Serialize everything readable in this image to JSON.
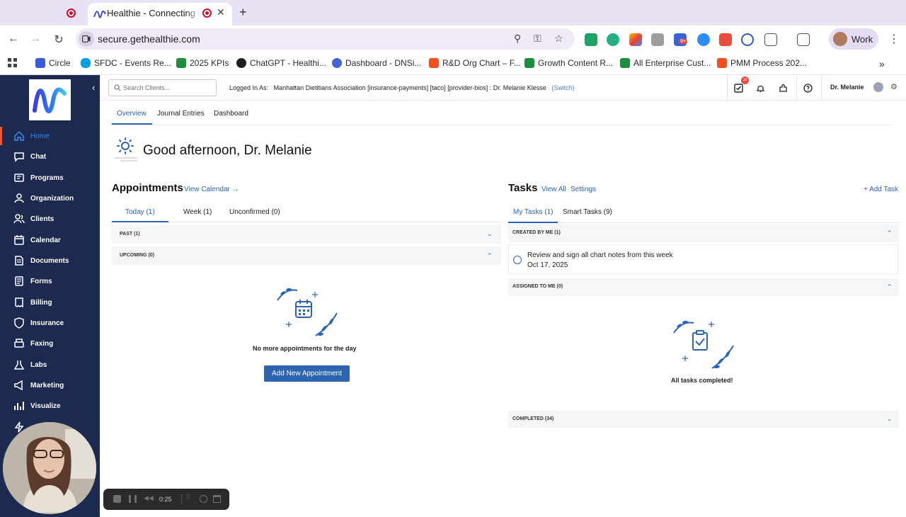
{
  "browser": {
    "active_tab_title": "Healthie - Connecting Pro",
    "url": "secure.gethealthie.com",
    "profile_label": "Work",
    "bookmarks": [
      {
        "label": "Circle",
        "color": "#3b5bdb"
      },
      {
        "label": "SFDC - Events Re...",
        "color": "#00a1e0"
      },
      {
        "label": "2025 KPIs",
        "color": "#1e8e3e"
      },
      {
        "label": "ChatGPT - Healthi...",
        "color": "#202020"
      },
      {
        "label": "Dashboard - DNSi...",
        "color": "#3f66d4"
      },
      {
        "label": "R&D Org Chart – F...",
        "color": "#f24e1e"
      },
      {
        "label": "Growth Content R...",
        "color": "#1e8e3e"
      },
      {
        "label": "All Enterprise Cust...",
        "color": "#1e8e3e"
      },
      {
        "label": "PMM Process 202...",
        "color": "#f24e1e"
      }
    ],
    "extension_badge": "9+"
  },
  "sidebar": {
    "items": [
      {
        "label": "Home",
        "icon": "home-icon"
      },
      {
        "label": "Chat",
        "icon": "chat-icon"
      },
      {
        "label": "Programs",
        "icon": "programs-icon"
      },
      {
        "label": "Organization",
        "icon": "organization-icon"
      },
      {
        "label": "Clients",
        "icon": "clients-icon"
      },
      {
        "label": "Calendar",
        "icon": "calendar-icon"
      },
      {
        "label": "Documents",
        "icon": "documents-icon"
      },
      {
        "label": "Forms",
        "icon": "forms-icon"
      },
      {
        "label": "Billing",
        "icon": "billing-icon"
      },
      {
        "label": "Insurance",
        "icon": "insurance-icon"
      },
      {
        "label": "Faxing",
        "icon": "fax-icon"
      },
      {
        "label": "Labs",
        "icon": "labs-icon"
      },
      {
        "label": "Marketing",
        "icon": "marketing-icon"
      },
      {
        "label": "Visualize",
        "icon": "visualize-icon"
      }
    ]
  },
  "topbar": {
    "search_placeholder": "Search Clients...",
    "logged_in_label": "Logged In As:",
    "logged_in_value": "Manhattan Dietitians Association [insurance-payments] [taco] [provider-bios] : Dr. Melanie Klesse",
    "switch_label": "(Switch)",
    "tasks_badge": "10",
    "user_name": "Dr. Melanie"
  },
  "subtabs": [
    "Overview",
    "Journal Entries",
    "Dashboard"
  ],
  "greeting": "Good afternoon, Dr. Melanie",
  "appointments": {
    "title": "Appointments",
    "view_link": "View Calendar →",
    "tabs": [
      "Today (1)",
      "Week (1)",
      "Unconfirmed (0)"
    ],
    "sections": [
      "PAST (1)",
      "UPCOMING (0)"
    ],
    "empty_text": "No more appointments for the day",
    "button": "Add New Appointment"
  },
  "tasks": {
    "title": "Tasks",
    "view_all": "View All",
    "settings": "Settings",
    "add_task": "+ Add Task",
    "tabs": [
      "My Tasks (1)",
      "Smart Tasks (9)"
    ],
    "created_by_me": "CREATED BY ME (1)",
    "task_title": "Review and sign all chart notes from this week",
    "task_date": "Oct 17, 2025",
    "assigned_to_me": "ASSIGNED TO ME (0)",
    "empty_text": "All tasks completed!",
    "completed": "COMPLETED (34)"
  },
  "recorder": {
    "time": "0:25"
  },
  "colors": {
    "sidebar_bg": "#1b2a4e",
    "accent": "#2c63b6",
    "active_marker": "#e95a3d"
  }
}
